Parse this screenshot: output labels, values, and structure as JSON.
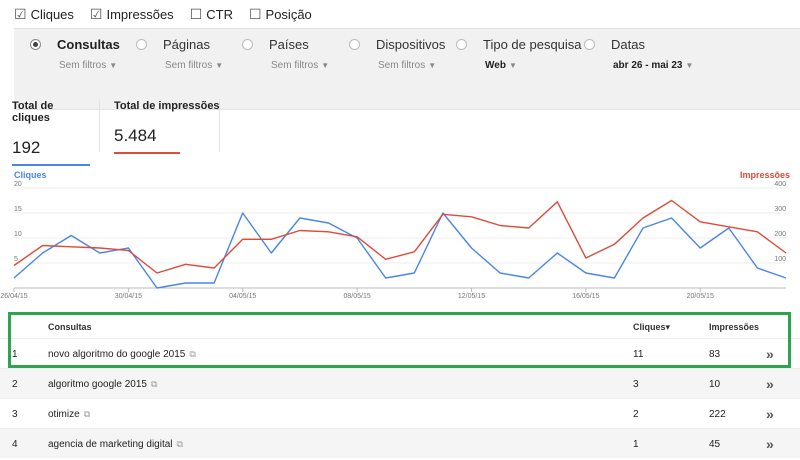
{
  "metrics": [
    {
      "label": "Cliques",
      "checked": true
    },
    {
      "label": "Impressões",
      "checked": true
    },
    {
      "label": "CTR",
      "checked": false
    },
    {
      "label": "Posição",
      "checked": false
    }
  ],
  "filters": [
    {
      "label": "Consultas",
      "sub": "Sem filtros",
      "selected": true
    },
    {
      "label": "Páginas",
      "sub": "Sem filtros",
      "selected": false
    },
    {
      "label": "Países",
      "sub": "Sem filtros",
      "selected": false
    },
    {
      "label": "Dispositivos",
      "sub": "Sem filtros",
      "selected": false
    },
    {
      "label": "Tipo de pesquisa",
      "sub": "Web",
      "selected": false
    },
    {
      "label": "Datas",
      "sub": "abr 26 - mai 23",
      "selected": false
    }
  ],
  "totals": {
    "clicks_label": "Total de cliques",
    "clicks_value": "192",
    "impr_label": "Total de impressões",
    "impr_value": "5.484"
  },
  "colors": {
    "clicks": "#4a86e8",
    "impressions": "#dd4b39",
    "highlight": "#2ea44f"
  },
  "chart_data": {
    "type": "line",
    "left_axis_label": "Cliques",
    "right_axis_label": "Impressões",
    "left_ticks": [
      "20",
      "15",
      "10",
      "5"
    ],
    "right_ticks": [
      "400",
      "300",
      "200",
      "100"
    ],
    "left_ylim": [
      0,
      20
    ],
    "right_ylim": [
      0,
      400
    ],
    "x_tick_labels": [
      "26/04/15",
      "30/04/15",
      "04/05/15",
      "08/05/15",
      "12/05/15",
      "16/05/15",
      "20/05/15"
    ],
    "x": [
      "26/04/15",
      "27/04/15",
      "28/04/15",
      "29/04/15",
      "30/04/15",
      "01/05/15",
      "02/05/15",
      "03/05/15",
      "04/05/15",
      "05/05/15",
      "06/05/15",
      "07/05/15",
      "08/05/15",
      "09/05/15",
      "10/05/15",
      "11/05/15",
      "12/05/15",
      "13/05/15",
      "14/05/15",
      "15/05/15",
      "16/05/15",
      "17/05/15",
      "18/05/15",
      "19/05/15",
      "20/05/15",
      "21/05/15",
      "22/05/15",
      "23/05/15"
    ],
    "series": [
      {
        "name": "Cliques",
        "axis": "left",
        "values": [
          2,
          7,
          10.5,
          7,
          8,
          0,
          1,
          1,
          15,
          7,
          14,
          13,
          10,
          2,
          3,
          15,
          8,
          3,
          2,
          7,
          3,
          2,
          12,
          14,
          8,
          12,
          4,
          2
        ]
      },
      {
        "name": "Impressões",
        "axis": "right",
        "values": [
          90,
          170,
          165,
          160,
          150,
          60,
          95,
          80,
          195,
          195,
          230,
          225,
          205,
          115,
          145,
          295,
          285,
          250,
          240,
          345,
          120,
          175,
          280,
          350,
          265,
          245,
          225,
          140
        ]
      }
    ]
  },
  "table": {
    "headers": {
      "query": "Consultas",
      "clicks": "Cliques▾",
      "impressions": "Impressões"
    },
    "rows": [
      {
        "n": "1",
        "query": "novo algoritmo do google 2015",
        "clicks": "11",
        "impressions": "83"
      },
      {
        "n": "2",
        "query": "algoritmo google 2015",
        "clicks": "3",
        "impressions": "10"
      },
      {
        "n": "3",
        "query": "otimize",
        "clicks": "2",
        "impressions": "222"
      },
      {
        "n": "4",
        "query": "agencia de marketing digital",
        "clicks": "1",
        "impressions": "45"
      }
    ],
    "go_glyph": "»",
    "ext_glyph": "⧉"
  }
}
